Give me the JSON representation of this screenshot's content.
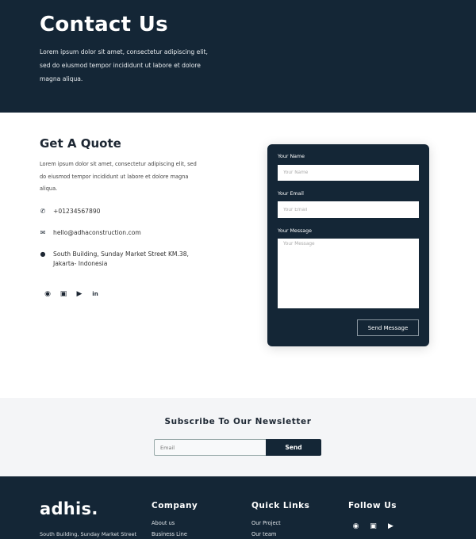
{
  "hero": {
    "title": "Contact Us",
    "text": "Lorem ipsum dolor sit amet, consectetur adipiscing elit, sed do eiusmod tempor incididunt ut labore et dolore magna aliqua."
  },
  "quote": {
    "title": "Get A Quote",
    "text": "Lorem ipsum dolor sit amet, consectetur adipiscing elit, sed do eiusmod tempor incididunt ut labore et dolore magna aliqua.",
    "phone": "+01234567890",
    "email": "hello@adhaconstruction.com",
    "address_line1": "South Building, Sunday Market Street KM.38,",
    "address_line2": "Jakarta- Indonesia",
    "social": [
      "facebook-icon",
      "instagram-icon",
      "youtube-icon",
      "linkedin-icon"
    ]
  },
  "form": {
    "name_label": "Your Name",
    "name_placeholder": "Your Name",
    "email_label": "Your Email",
    "email_placeholder": "Your Email",
    "message_label": "Your Message",
    "message_placeholder": "Your Message",
    "submit": "Send Message"
  },
  "newsletter": {
    "title": "Subscribe To Our Newsletter",
    "placeholder": "Email",
    "button": "Send"
  },
  "footer": {
    "logo": "adhis.",
    "address": "South Building, Sunday Market Street",
    "company": {
      "title": "Company",
      "links": [
        "About us",
        "Business Line"
      ]
    },
    "quick_links": {
      "title": "Quick Links",
      "links": [
        "Our Project",
        "Our team"
      ]
    },
    "follow": {
      "title": "Follow Us",
      "icons": [
        "facebook-icon",
        "instagram-icon",
        "youtube-icon"
      ]
    }
  },
  "colors": {
    "primary": "#142636",
    "newsletter_bg": "#f4f5f7"
  }
}
